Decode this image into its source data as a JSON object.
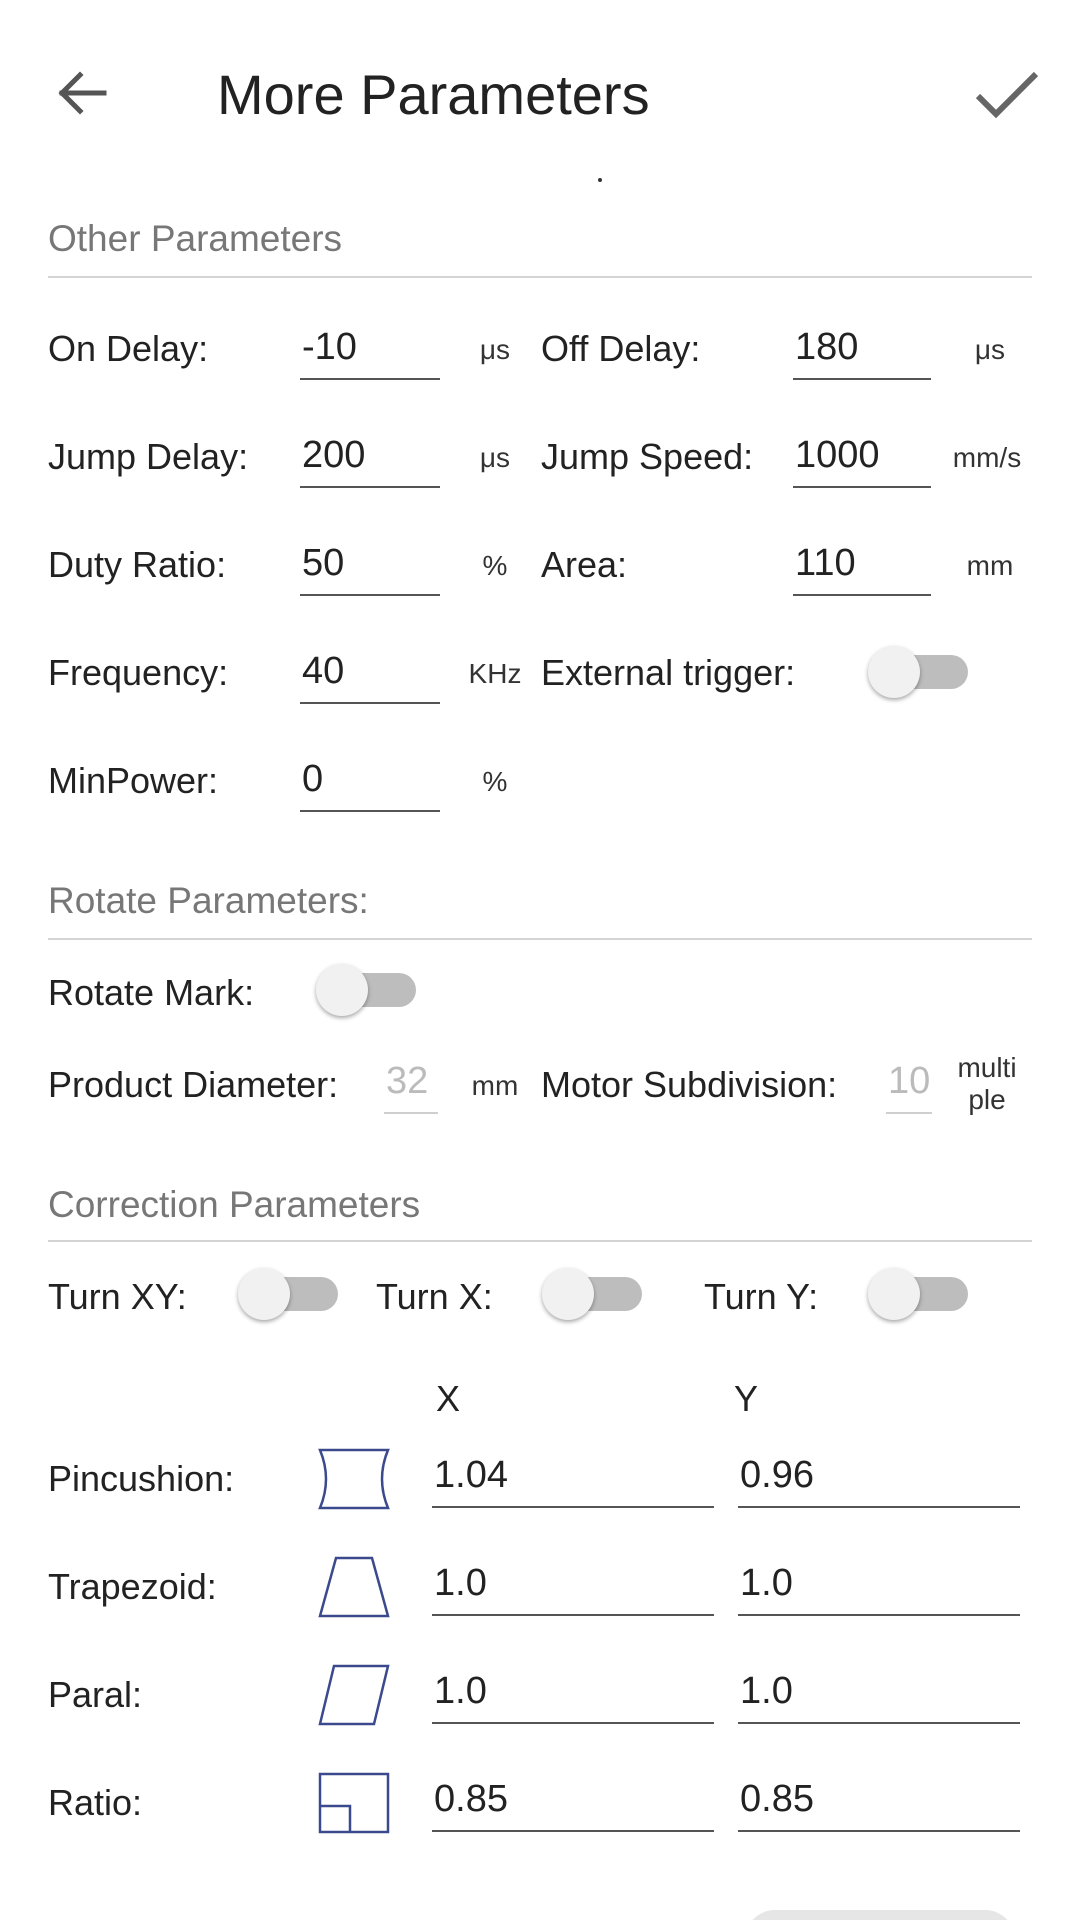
{
  "header": {
    "title": "More Parameters",
    "back_icon": "arrow-left-icon",
    "confirm_icon": "checkmark-icon"
  },
  "other": {
    "title": "Other Parameters",
    "on_delay": {
      "label": "On Delay:",
      "value": "-10",
      "unit": "μs"
    },
    "off_delay": {
      "label": "Off Delay:",
      "value": "180",
      "unit": "μs"
    },
    "jump_delay": {
      "label": "Jump Delay:",
      "value": "200",
      "unit": "μs"
    },
    "jump_speed": {
      "label": "Jump Speed:",
      "value": "1000",
      "unit": "mm/s"
    },
    "duty_ratio": {
      "label": "Duty Ratio:",
      "value": "50",
      "unit": "%"
    },
    "area": {
      "label": "Area:",
      "value": "110",
      "unit": "mm"
    },
    "frequency": {
      "label": "Frequency:",
      "value": "40",
      "unit": "KHz"
    },
    "external_trigger": {
      "label": "External trigger:",
      "on": false
    },
    "min_power": {
      "label": "MinPower:",
      "value": "0",
      "unit": "%"
    }
  },
  "rotate": {
    "title": "Rotate Parameters:",
    "rotate_mark": {
      "label": "Rotate Mark:",
      "on": false
    },
    "product_diameter": {
      "label": "Product Diameter:",
      "value": "32",
      "unit": "mm"
    },
    "motor_subdivision": {
      "label": "Motor Subdivision:",
      "value": "10",
      "unit_line1": "multi",
      "unit_line2": "ple"
    }
  },
  "correction": {
    "title": "Correction Parameters",
    "turn_xy": {
      "label": "Turn XY:",
      "on": false
    },
    "turn_x": {
      "label": "Turn X:",
      "on": false
    },
    "turn_y": {
      "label": "Turn Y:",
      "on": false
    },
    "col_x": "X",
    "col_y": "Y",
    "rows": [
      {
        "label": "Pincushion:",
        "icon": "pincushion-shape-icon",
        "x": "1.04",
        "y": "0.96"
      },
      {
        "label": "Trapezoid:",
        "icon": "trapezoid-shape-icon",
        "x": "1.0",
        "y": "1.0"
      },
      {
        "label": "Paral:",
        "icon": "parallelogram-shape-icon",
        "x": "1.0",
        "y": "1.0"
      },
      {
        "label": "Ratio:",
        "icon": "ratio-shape-icon",
        "x": "0.85",
        "y": "0.85"
      }
    ]
  },
  "colors": {
    "accent_icon": "#3a4a8c",
    "section_title": "#777777",
    "divider": "#d4d4d4"
  }
}
